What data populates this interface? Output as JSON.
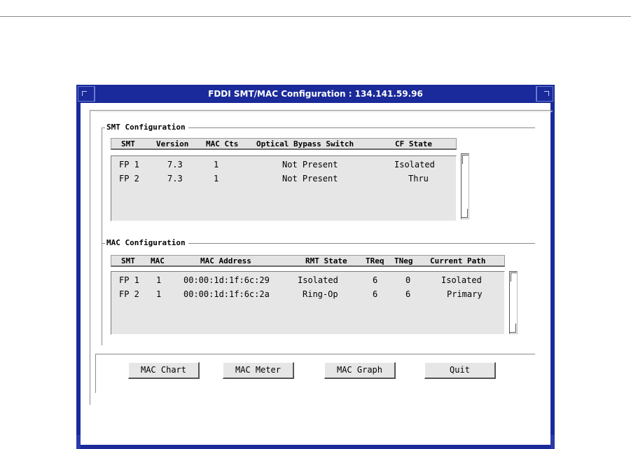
{
  "window": {
    "title": "FDDI SMT/MAC Configuration : 134.141.59.96"
  },
  "smt_config": {
    "legend": "SMT Configuration",
    "columns": [
      "SMT",
      "Version",
      "MAC Cts",
      "Optical Bypass Switch",
      "CF State"
    ],
    "rows": [
      [
        "FP 1",
        "7.3",
        "1",
        "Not Present",
        "Isolated"
      ],
      [
        "FP 2",
        "7.3",
        "1",
        "Not Present",
        "Thru"
      ]
    ]
  },
  "mac_config": {
    "legend": "MAC Configuration",
    "columns": [
      "SMT",
      "MAC",
      "MAC Address",
      "RMT State",
      "TReq",
      "TNeg",
      "Current Path"
    ],
    "rows": [
      [
        "FP 1",
        "1",
        "00:00:1d:1f:6c:29",
        "Isolated",
        "6",
        "0",
        "Isolated"
      ],
      [
        "FP 2",
        "1",
        "00:00:1d:1f:6c:2a",
        "Ring-Op",
        "6",
        "6",
        "Primary"
      ]
    ]
  },
  "buttons": {
    "mac_chart": "MAC Chart",
    "mac_meter": "MAC Meter",
    "mac_graph": "MAC Graph",
    "quit": "Quit"
  },
  "colors": {
    "titlebar": "#1a2a9a",
    "panel": "#e6e6e6"
  }
}
